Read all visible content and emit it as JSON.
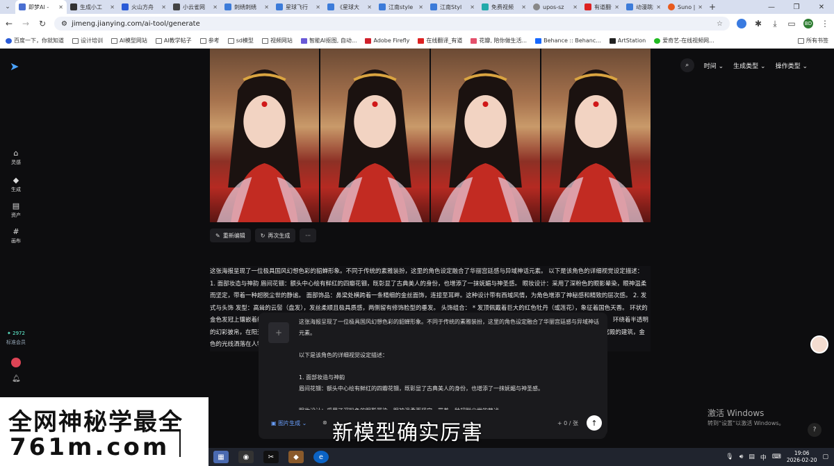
{
  "browser": {
    "tabs": [
      {
        "label": "即梦AI -",
        "active": true
      },
      {
        "label": "生成小工"
      },
      {
        "label": "火山方舟"
      },
      {
        "label": "小云雀网"
      },
      {
        "label": "刺绣刺绣"
      },
      {
        "label": "星球飞行"
      },
      {
        "label": "《星球大"
      },
      {
        "label": "江南style"
      },
      {
        "label": "江南Styl"
      },
      {
        "label": "免费视频"
      },
      {
        "label": "upos-sz"
      },
      {
        "label": "有道翻译"
      },
      {
        "label": "动漫跳舞"
      },
      {
        "label": "Suno |"
      }
    ],
    "new_tab": "+",
    "url": "jimeng.jianying.com/ai-tool/generate",
    "profile": "BD",
    "bookmarks": [
      "百度一下，你就知道",
      "设计培训",
      "AI模型网站",
      "AI教学帖子",
      "参考",
      "sd模型",
      "视频网站",
      "智能AI抠图, 自动...",
      "Adobe Firefly",
      "在线翻译_有道",
      "花瓣, 陪你做生活...",
      "Behance :: Behanc...",
      "ArtStation",
      "爱奇艺-在线视频网..."
    ],
    "bookmarks_right": "所有书签"
  },
  "sidebar": {
    "items": [
      {
        "label": "灵感",
        "icon": "home-icon"
      },
      {
        "label": "生成",
        "icon": "generate-icon"
      },
      {
        "label": "资产",
        "icon": "assets-icon"
      },
      {
        "label": "画布",
        "icon": "canvas-icon"
      }
    ],
    "credits": "2972",
    "membership": "标准会员"
  },
  "filters": {
    "time": "时间",
    "gen_type": "生成类型",
    "op_type": "操作类型"
  },
  "actions": {
    "reedit": "重新编辑",
    "regenerate": "再次生成",
    "more": "···"
  },
  "description": "这张海报呈现了一位极具国风幻想色彩的貂蝉形象。不同于传统的素雅装扮，这里的角色设定融合了华丽宫廷感与异域神话元素。 以下是该角色的详细视觉设定描述： 1. 面部妆造与神韵 眉间花钿：额头中心绘有鲜红的四瓣花钿，既彰显了古典美人的身份，也增添了一抹妩媚与神圣感。 眼妆设计：采用了深粉色的眼影晕染，眼神温柔而坚定，带着一种超脱尘世的静谧。 面部饰品：鼻梁处横跨着一条精细的金丝面饰，连接至耳畔。这种设计带有西域风情，为角色增添了神秘感和精致的层次感。 2. 发式与头饰 发型：高耸的云髻（盘发），发丝柔顺且极具质感，两侧留有修饰脸型的垂发。 头饰组合： * 发顶佩戴着巨大的红色牡丹（或莲花），象征着国色天香。 环状的金色发冠上镶嵌着绿宝石与红宝石，后方垂挂着长长的金色流苏，随着微风轻动。 3. 服饰与材质 上身为深红色的锦缎华服，领口饰有金色的护甲状装饰。 环绕着半透明的幻彩披帛，在阳光下折射出梦幻的光泽。 角色肩部的披帛呈现出多彩的珍珠光泽，暗示这位貂蝉可能具有神仙或异域的血统。 氛围：背景呈现出古典宫殿的建筑，金色的光线洒落在人物身上，使画面更加明亮。",
  "popup": {
    "intro": "这张海报呈现了一位极具国风幻想色彩的貂蝉形象。不同于传统的素雅装扮，这里的角色设定融合了华丽宫廷感与异域神话元素。",
    "list_title": "以下是该角色的详细视觉设定描述：",
    "section1": "1. 面部妆造与神韵",
    "line1": "眉间花钿：额头中心绘有鲜红的四瓣花钿，既彰显了古典美人的身份，也增添了一抹妩媚与神圣感。",
    "line2": "眼妆设计：采用了深粉色的眼影晕染，眼神温柔而坚定，带着一种超脱尘世的静谧。"
  },
  "composer": {
    "mode": "图片生成",
    "count": "+ 0 / 张"
  },
  "subtitle": "新模型确实厉害",
  "watermark": {
    "line1": "全网神秘学最全",
    "line2": "761m.com"
  },
  "windows": {
    "activate_title": "激活 Windows",
    "activate_sub": "转到“设置”以激活 Windows。",
    "time": "19:06",
    "date": "2026-02-20",
    "ime": "中"
  }
}
